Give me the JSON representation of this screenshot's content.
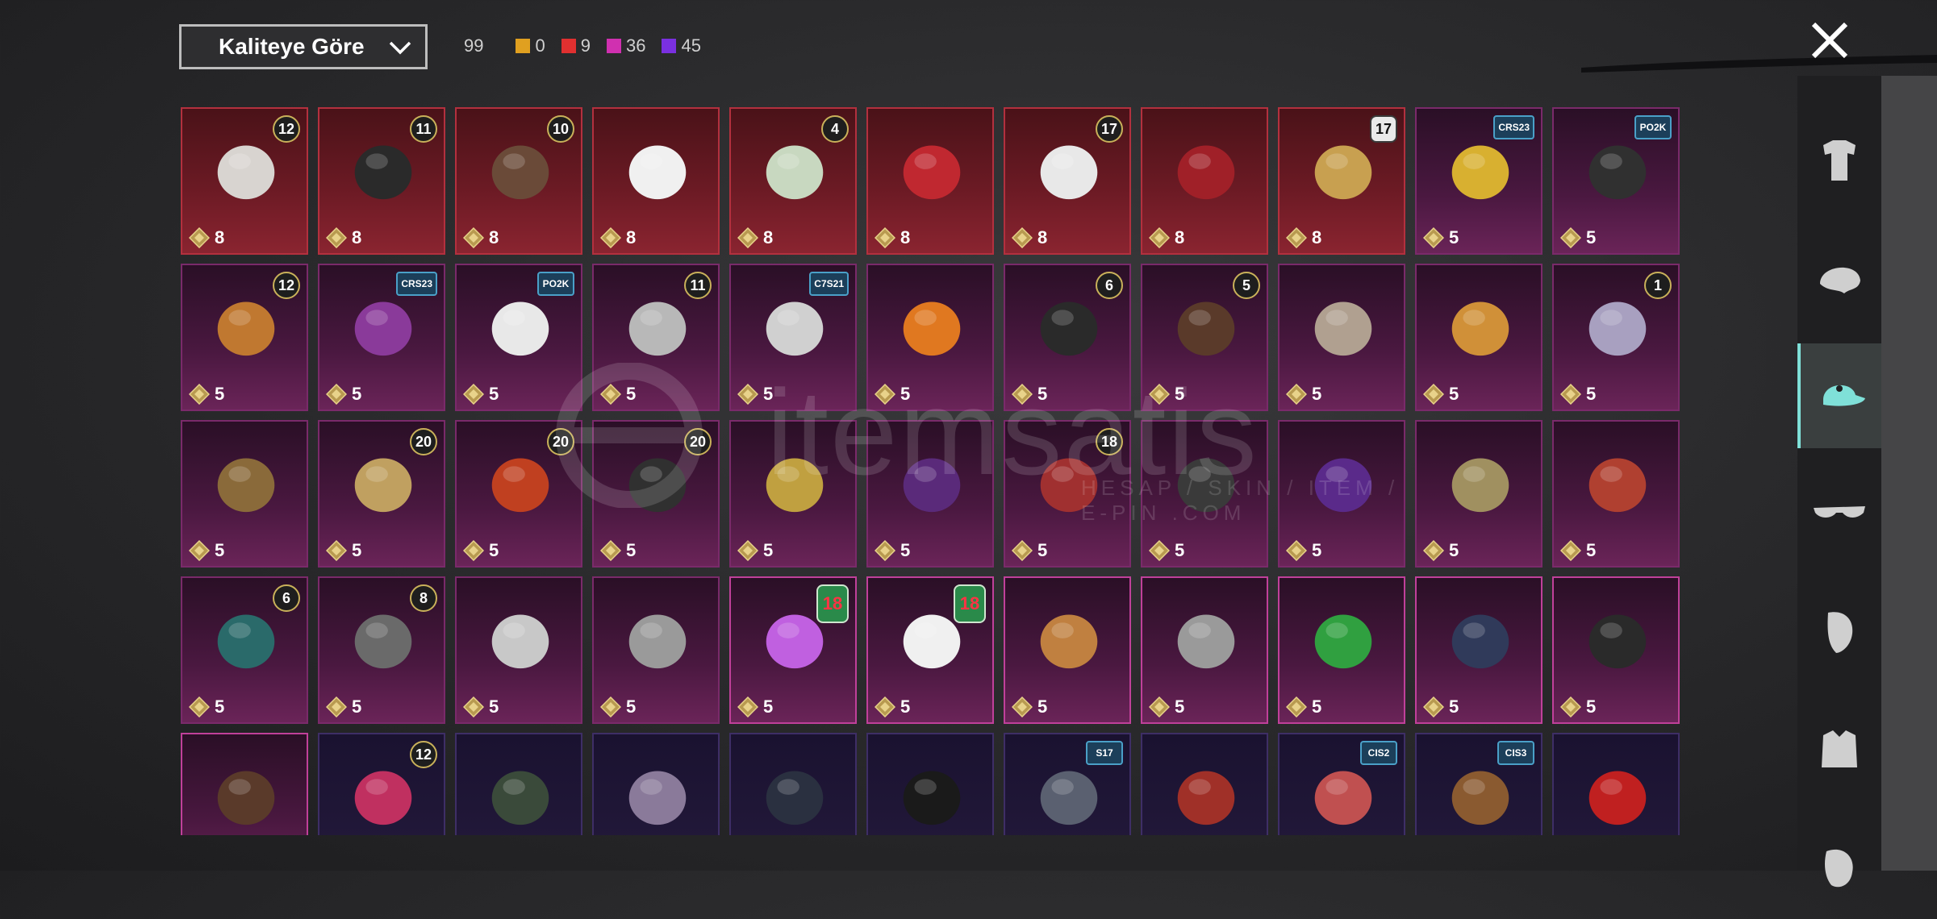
{
  "toolbar": {
    "sort_label": "Kaliteye Göre",
    "total_count": "99",
    "rarity_counts": [
      {
        "color": "#e0a020",
        "count": "0"
      },
      {
        "color": "#e03030",
        "count": "9"
      },
      {
        "color": "#d030b0",
        "count": "36"
      },
      {
        "color": "#7a30e0",
        "count": "45"
      }
    ],
    "close_icon": "close-icon"
  },
  "watermark": {
    "brand": "itemsatis",
    "tagline": "HESAP / SKIN / ITEM / E-PIN .COM"
  },
  "categories": [
    {
      "icon": "outfit-icon"
    },
    {
      "icon": "hair-icon"
    },
    {
      "icon": "hat-icon",
      "active": true
    },
    {
      "icon": "glasses-icon"
    },
    {
      "icon": "mask-icon"
    },
    {
      "icon": "jacket-icon"
    },
    {
      "icon": "face-icon"
    }
  ],
  "items": [
    {
      "rarity": "red",
      "badge": "12",
      "cost": "8",
      "art": "#d8d4d0"
    },
    {
      "rarity": "red",
      "badge": "11",
      "cost": "8",
      "art": "#2a2a2a"
    },
    {
      "rarity": "red",
      "badge": "10",
      "cost": "8",
      "art": "#6a4a38"
    },
    {
      "rarity": "red",
      "badge": "",
      "cost": "8",
      "art": "#f0f0f0"
    },
    {
      "rarity": "red",
      "badge": "4",
      "cost": "8",
      "art": "#c8d8c0"
    },
    {
      "rarity": "red",
      "badge": "",
      "cost": "8",
      "art": "#c02830"
    },
    {
      "rarity": "red",
      "badge": "17",
      "cost": "8",
      "art": "#e8e8e8"
    },
    {
      "rarity": "red",
      "badge": "",
      "cost": "8",
      "art": "#a02028"
    },
    {
      "rarity": "red",
      "badge": "17",
      "badge_style": "big",
      "cost": "8",
      "art": "#c8a050"
    },
    {
      "rarity": "purple",
      "badge": "CRS23",
      "badge_style": "tag",
      "cost": "5",
      "art": "#d8b030"
    },
    {
      "rarity": "purple",
      "badge": "PO2K",
      "badge_style": "tag",
      "cost": "5",
      "art": "#303030"
    },
    {
      "rarity": "purple",
      "badge": "12",
      "cost": "5",
      "art": "#c07830"
    },
    {
      "rarity": "purple",
      "badge": "CRS23",
      "badge_style": "tag",
      "cost": "5",
      "art": "#8a3a9a"
    },
    {
      "rarity": "purple",
      "badge": "PO2K",
      "badge_style": "tag",
      "cost": "5",
      "art": "#e8e8e8"
    },
    {
      "rarity": "purple",
      "badge": "11",
      "cost": "5",
      "art": "#b8b8b8"
    },
    {
      "rarity": "purple",
      "badge": "C7S21",
      "badge_style": "tag",
      "cost": "5",
      "art": "#d0d0d0"
    },
    {
      "rarity": "purple",
      "badge": "",
      "cost": "5",
      "art": "#e07820"
    },
    {
      "rarity": "purple",
      "badge": "6",
      "cost": "5",
      "art": "#2a2a2a"
    },
    {
      "rarity": "purple",
      "badge": "5",
      "cost": "5",
      "art": "#5a3a2a"
    },
    {
      "rarity": "purple",
      "badge": "",
      "cost": "5",
      "art": "#b0a090"
    },
    {
      "rarity": "purple",
      "badge": "",
      "cost": "5",
      "art": "#d09038"
    },
    {
      "rarity": "purple",
      "badge": "1",
      "cost": "5",
      "art": "#a8a0c0"
    },
    {
      "rarity": "purple",
      "badge": "",
      "cost": "5",
      "art": "#8a6a3a"
    },
    {
      "rarity": "purple",
      "badge": "20",
      "cost": "5",
      "art": "#c0a060"
    },
    {
      "rarity": "purple",
      "badge": "20",
      "cost": "5",
      "art": "#c04020"
    },
    {
      "rarity": "purple",
      "badge": "20",
      "cost": "5",
      "art": "#303030"
    },
    {
      "rarity": "purple",
      "badge": "",
      "cost": "5",
      "art": "#c0a040"
    },
    {
      "rarity": "purple",
      "badge": "",
      "cost": "5",
      "art": "#5a2a7a"
    },
    {
      "rarity": "purple",
      "badge": "18",
      "cost": "5",
      "art": "#a03030"
    },
    {
      "rarity": "purple",
      "badge": "",
      "cost": "5",
      "art": "#3a3a3a"
    },
    {
      "rarity": "purple",
      "badge": "",
      "cost": "5",
      "art": "#5a2a8a"
    },
    {
      "rarity": "purple",
      "badge": "",
      "cost": "5",
      "art": "#a09060"
    },
    {
      "rarity": "purple",
      "badge": "",
      "cost": "5",
      "art": "#b04030"
    },
    {
      "rarity": "purple",
      "badge": "6",
      "cost": "5",
      "art": "#2a6a6a"
    },
    {
      "rarity": "purple",
      "badge": "8",
      "cost": "5",
      "art": "#6a6a6a"
    },
    {
      "rarity": "purple",
      "badge": "",
      "cost": "5",
      "art": "#c8c8c8"
    },
    {
      "rarity": "purple",
      "badge": "",
      "cost": "5",
      "art": "#9a9a9a"
    },
    {
      "rarity": "purple",
      "hl": true,
      "badge": "18",
      "badge_style": "eighteen",
      "cost": "5",
      "art": "#c060e0"
    },
    {
      "rarity": "purple",
      "hl": true,
      "badge": "18",
      "badge_style": "eighteen",
      "cost": "5",
      "art": "#f0f0f0"
    },
    {
      "rarity": "purple",
      "hl": true,
      "badge": "",
      "cost": "5",
      "art": "#c08040"
    },
    {
      "rarity": "purple",
      "hl": true,
      "badge": "",
      "cost": "5",
      "art": "#9a9a9a"
    },
    {
      "rarity": "purple",
      "hl": true,
      "badge": "",
      "cost": "5",
      "art": "#30a040"
    },
    {
      "rarity": "purple",
      "hl": true,
      "badge": "",
      "cost": "5",
      "art": "#303a5a"
    },
    {
      "rarity": "purple",
      "hl": true,
      "badge": "",
      "cost": "5",
      "art": "#2a2a2a"
    },
    {
      "rarity": "purple",
      "hl": true,
      "badge": "",
      "cost": "",
      "art": "#5a3a2a"
    },
    {
      "rarity": "violet",
      "badge": "12",
      "cost": "",
      "art": "#c03060"
    },
    {
      "rarity": "violet",
      "badge": "",
      "cost": "",
      "art": "#3a4a3a"
    },
    {
      "rarity": "violet",
      "badge": "",
      "cost": "",
      "art": "#8a7a9a"
    },
    {
      "rarity": "violet",
      "badge": "",
      "cost": "",
      "art": "#2a3040"
    },
    {
      "rarity": "violet",
      "badge": "",
      "cost": "",
      "art": "#1a1a1a"
    },
    {
      "rarity": "violet",
      "badge": "S17",
      "badge_style": "tag",
      "cost": "",
      "art": "#5a6070"
    },
    {
      "rarity": "violet",
      "badge": "",
      "cost": "",
      "art": "#a03028"
    },
    {
      "rarity": "violet",
      "badge": "CIS2",
      "badge_style": "tag",
      "cost": "",
      "art": "#c05050"
    },
    {
      "rarity": "violet",
      "badge": "CIS3",
      "badge_style": "tag",
      "cost": "",
      "art": "#8a5a30"
    },
    {
      "rarity": "violet",
      "badge": "",
      "cost": "",
      "art": "#c02020"
    }
  ]
}
